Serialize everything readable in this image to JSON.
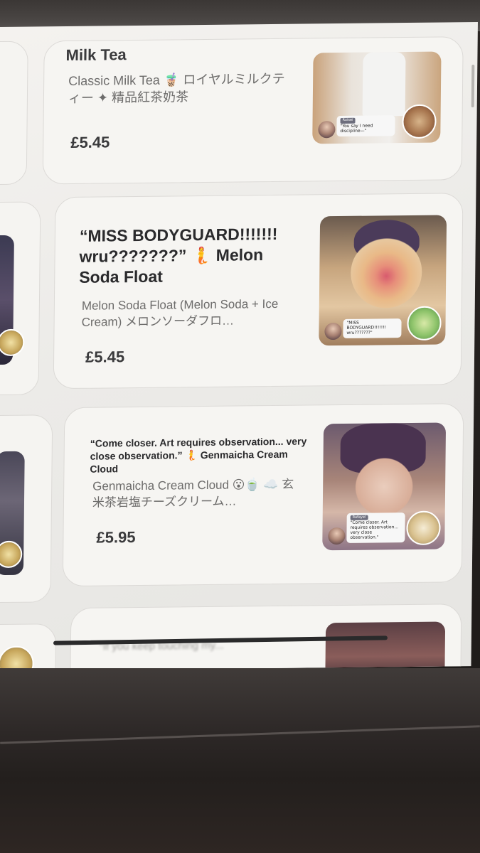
{
  "items": [
    {
      "title": "Milk Tea",
      "description": "Classic Milk Tea 🧋 ロイヤルミルクティー ✦ 精品紅茶奶茶",
      "price": "£5.45",
      "thumbnail": {
        "bubble_tag": "Ruisei",
        "bubble_text": "\"You say I need discipline—\""
      }
    },
    {
      "title": "“MISS BODYGUARD!!!!!!! wru???????” 🧜 Melon Soda Float",
      "description": "Melon Soda Float (Melon Soda + Ice Cream) メロンソーダフロ…",
      "price": "£5.45",
      "thumbnail": {
        "bubble_text": "\"MISS BODYGUARD!!!!!!! wru???????\""
      }
    },
    {
      "title": "“Come closer. Art requires observation... very close observation.” 🧜 Genmaicha Cream Cloud",
      "description": "Genmaicha Cream Cloud 😮🍵 ☁️ 玄米茶岩塩チーズクリーム…",
      "price": "£5.95",
      "thumbnail": {
        "bubble_tag": "Rafayel",
        "bubble_text": "\"Come closer. Art requires observation... very close observation.\""
      }
    },
    {
      "title": "“If you keep touching my..."
    }
  ],
  "colors": {
    "screen_bg": "#efeeeb",
    "card_border": "#dcdad7",
    "title_text": "#2a2a2c",
    "desc_text": "#6d6c6b"
  },
  "icons": [
    "chat-bubble",
    "drink-badge",
    "avatar"
  ]
}
